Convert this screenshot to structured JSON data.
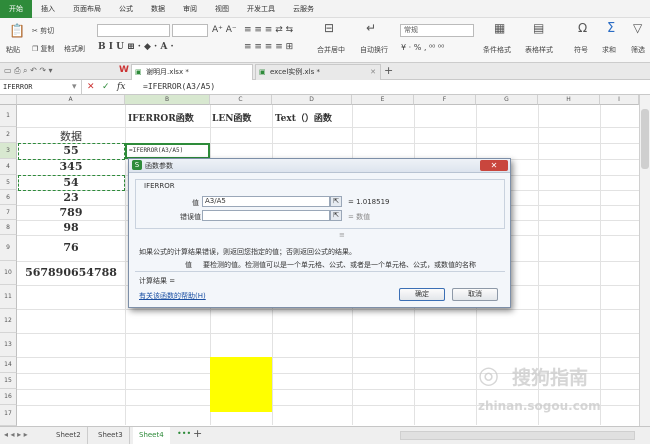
{
  "menu": {
    "tabs": [
      "开始",
      "插入",
      "页面布局",
      "公式",
      "数据",
      "审阅",
      "视图",
      "开发工具",
      "云服务"
    ]
  },
  "ribbon": {
    "paste": "粘贴",
    "cut": "剪切",
    "copy": "复制",
    "format_painter": "格式刷",
    "merge_center": "合并居中",
    "wrap_text": "自动换行",
    "number_format": "常规",
    "cond_format": "条件格式",
    "table_style": "表格样式",
    "symbol": "符号",
    "sum": "求和",
    "filter": "筛选"
  },
  "doc_tabs": {
    "file1": "谢明月.xlsx *",
    "file2": "excel实例.xls *"
  },
  "formula_bar": {
    "name_box": "IFERROR",
    "formula": "=IFERROR(A3/A5)"
  },
  "grid": {
    "columns": [
      "A",
      "B",
      "C",
      "D",
      "E",
      "F",
      "G",
      "H",
      "I"
    ],
    "rows": [
      "1",
      "2",
      "3",
      "4",
      "5",
      "6",
      "7",
      "8",
      "9",
      "10",
      "11",
      "12",
      "13",
      "14",
      "15",
      "16",
      "17"
    ],
    "b1": "IFERROR函数",
    "c1": "LEN函数",
    "d1": "Text（）函数",
    "a2": "数据",
    "a_values": [
      "55",
      "345",
      "54",
      "23",
      "789",
      "98",
      "76",
      "567890654788"
    ],
    "b3": "=IFERROR(A3/A5)",
    "highlight_color": "#ffff00"
  },
  "dialog": {
    "title": "函数参数",
    "close": "✕",
    "function_name": "IFERROR",
    "value_label": "值",
    "value_input": "A3/A5",
    "value_result": "= 1.018519",
    "error_label": "错误值",
    "error_result": "= 数值",
    "description": "如果公式的计算结果错误，则返回您指定的值；否则返回公式的结果。",
    "param_name": "值",
    "param_desc": "要检测的值。检测值可以是一个单元格、公式、或者是一个单元格、公式，或数值的名称",
    "calc_result": "计算结果 =",
    "help_link": "有关该函数的帮助(H)",
    "ok": "确定",
    "cancel": "取消"
  },
  "sheets": [
    "Sheet2",
    "Sheet3",
    "Sheet4"
  ],
  "watermark": {
    "cn": "搜狗指南",
    "en": "zhinan.sogou.com"
  },
  "colors": {
    "accent": "#2e8b3a",
    "link": "#1a4fa3"
  }
}
